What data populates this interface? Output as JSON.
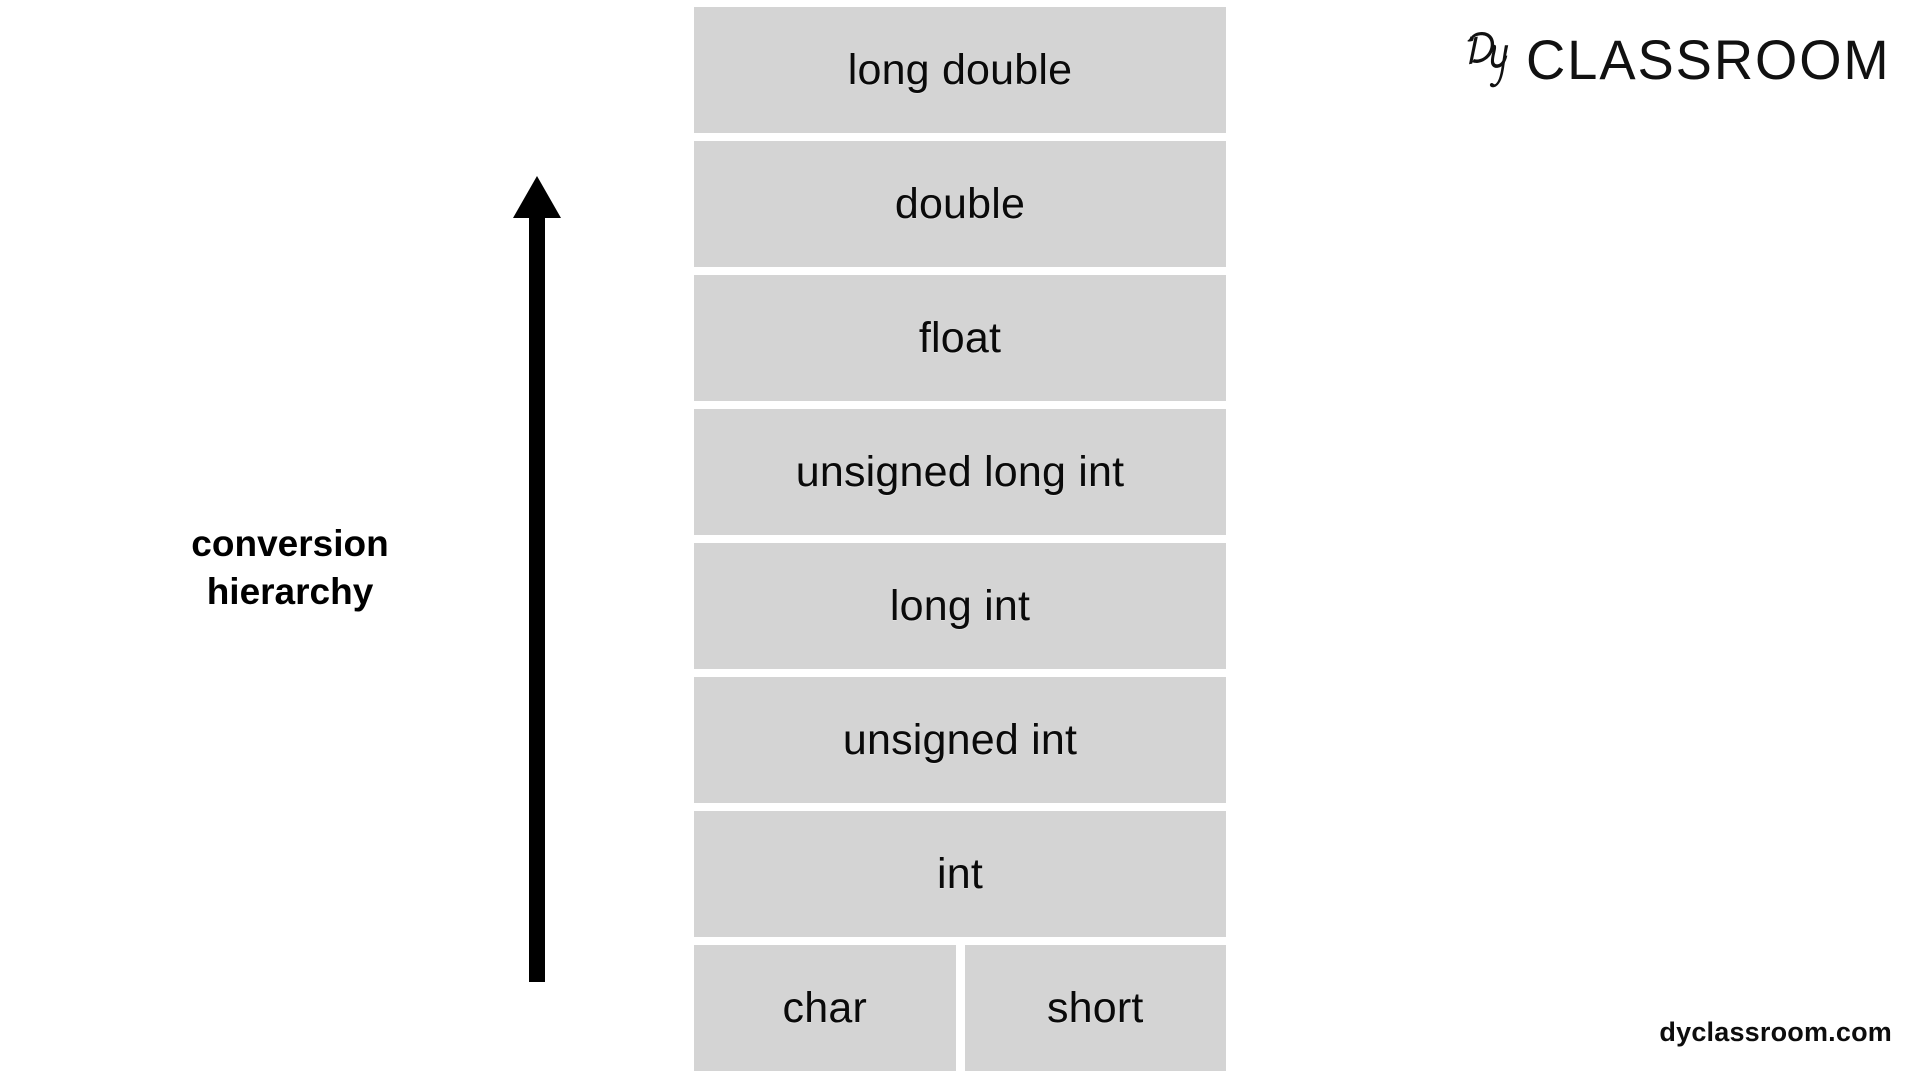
{
  "brand": {
    "logo_monogram": "Dy",
    "logo_word": "CLASSROOM",
    "logo_icon_name": "dy-script-monogram-icon"
  },
  "annotation": {
    "arrow_icon_name": "up-arrow-icon",
    "arrow_direction": "up",
    "label": "conversion\nhierarchy"
  },
  "diagram": {
    "title": "conversion hierarchy",
    "type": "hierarchy-stack",
    "box_fill_color": "#d4d4d4",
    "text_color": "#000000",
    "background_color": "#ffffff",
    "levels": [
      {
        "rank": 9,
        "cells": [
          {
            "label": "long double"
          }
        ]
      },
      {
        "rank": 8,
        "cells": [
          {
            "label": "double"
          }
        ]
      },
      {
        "rank": 7,
        "cells": [
          {
            "label": "float"
          }
        ]
      },
      {
        "rank": 6,
        "cells": [
          {
            "label": "unsigned long int"
          }
        ]
      },
      {
        "rank": 5,
        "cells": [
          {
            "label": "long int"
          }
        ]
      },
      {
        "rank": 4,
        "cells": [
          {
            "label": "unsigned int"
          }
        ]
      },
      {
        "rank": 3,
        "cells": [
          {
            "label": "int"
          }
        ]
      },
      {
        "rank": 1,
        "cells": [
          {
            "label": "char"
          },
          {
            "label": "short"
          }
        ]
      }
    ]
  },
  "footer": {
    "site": "dyclassroom.com"
  }
}
